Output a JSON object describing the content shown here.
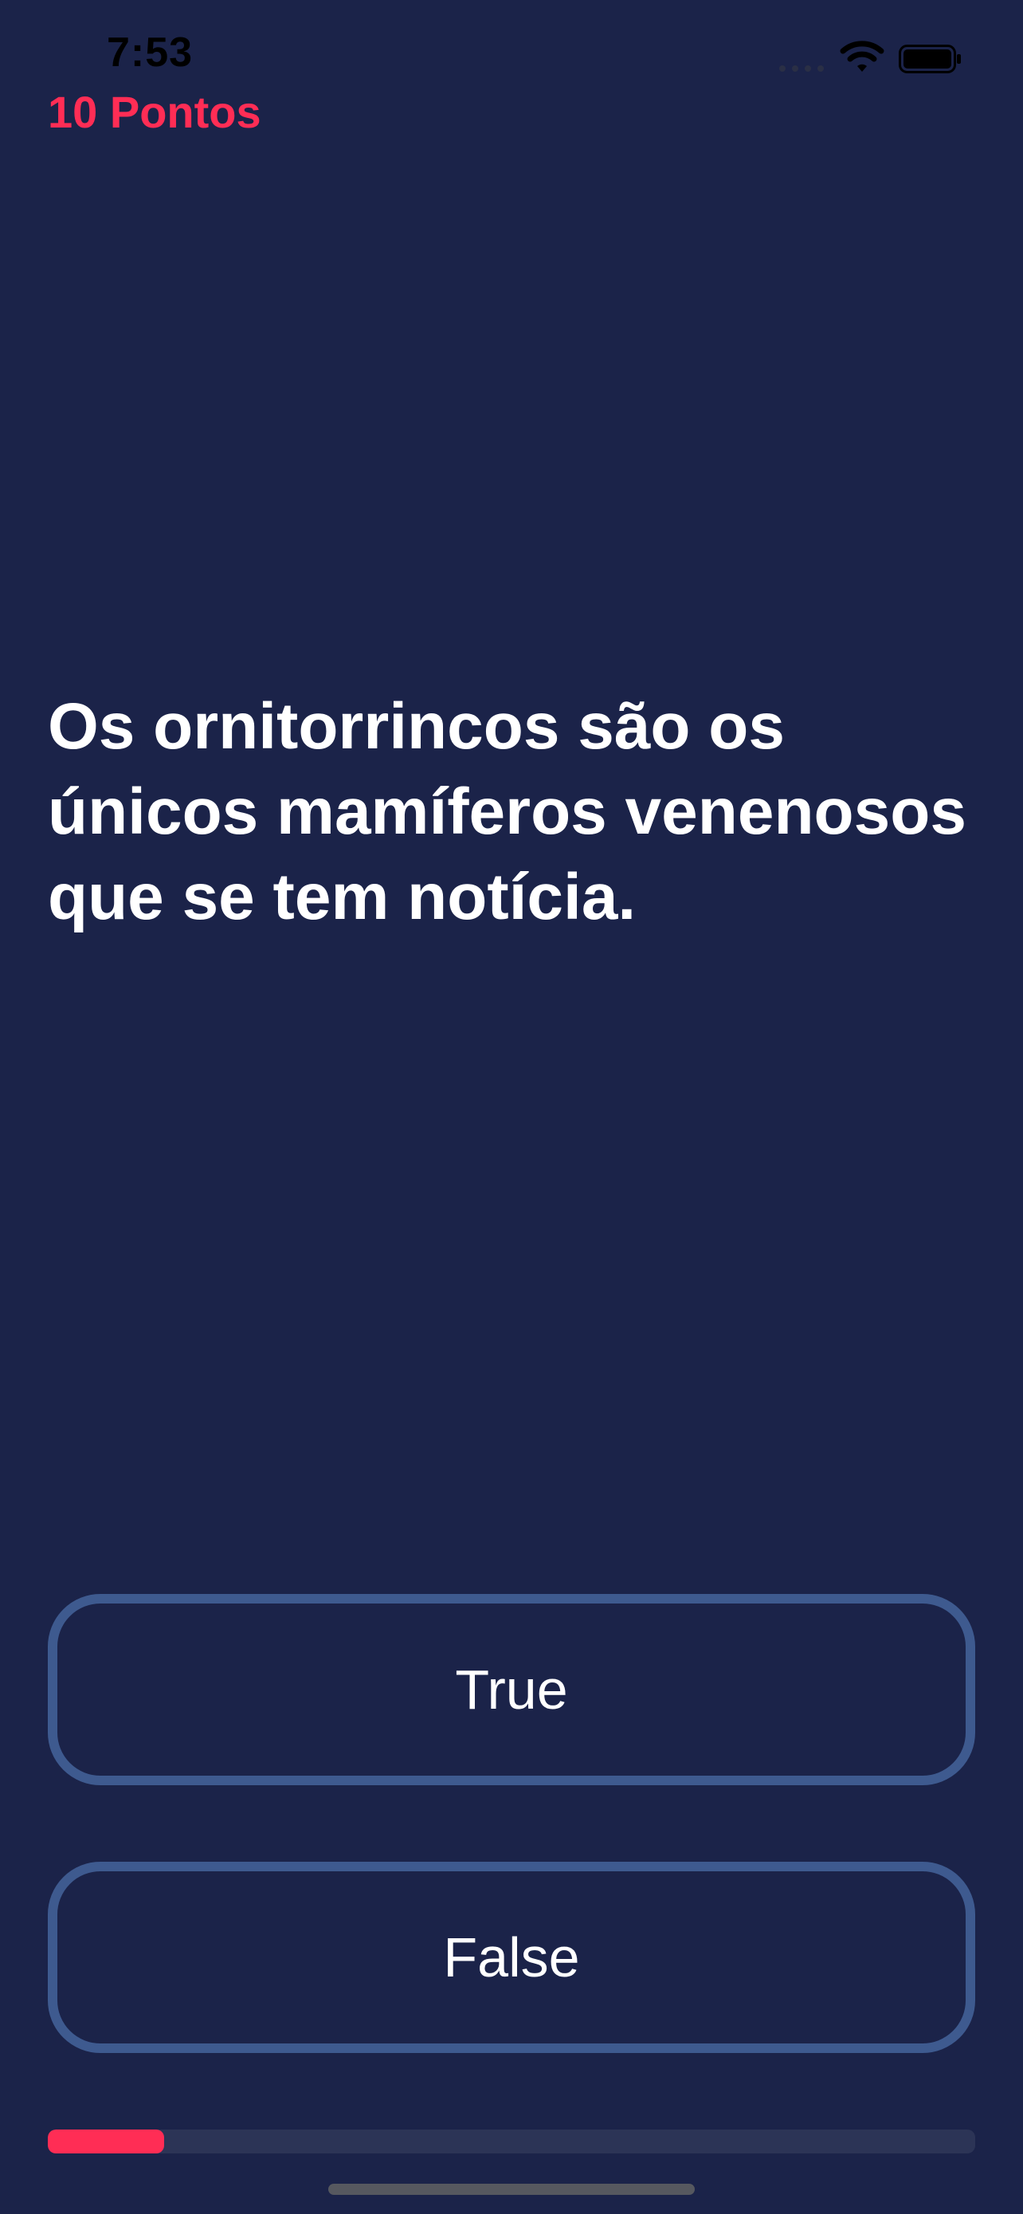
{
  "status_bar": {
    "time": "7:53",
    "icons": [
      "cellular-signal-icon",
      "wifi-icon",
      "battery-icon"
    ]
  },
  "score": {
    "label": "10 Pontos"
  },
  "question": {
    "text": "Os ornitorrincos são os únicos mamíferos venenosos que se tem notícia."
  },
  "answers": {
    "true_label": "True",
    "false_label": "False"
  },
  "progress": {
    "fraction": 0.125
  },
  "colors": {
    "background": "#1b2349",
    "accent": "#ff2d55",
    "button_border": "#3e5a8f",
    "text": "#ffffff",
    "progress_track": "#2c3456"
  }
}
